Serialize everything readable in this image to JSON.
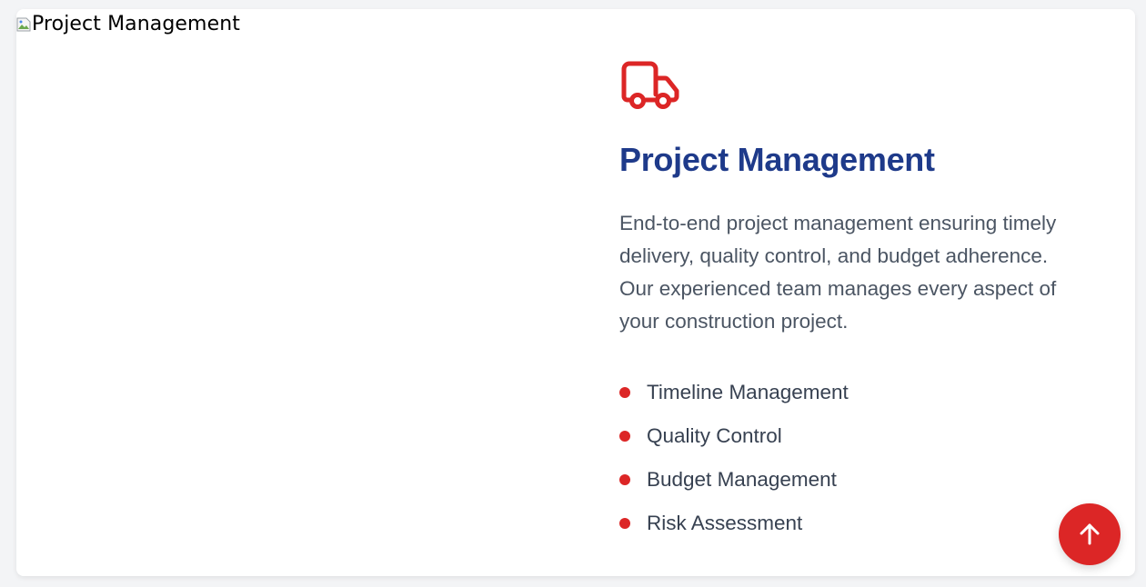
{
  "service": {
    "image_alt": "Project Management",
    "icon": "truck-icon",
    "title": "Project Management",
    "description": "End-to-end project management ensuring timely delivery, quality control, and budget adherence. Our experienced team manages every aspect of your construction project.",
    "features": [
      "Timeline Management",
      "Quality Control",
      "Budget Management",
      "Risk Assessment"
    ]
  },
  "scroll_top": {
    "icon": "arrow-up-icon"
  },
  "colors": {
    "accent": "#dc2626",
    "title": "#1e3a8a",
    "body_text": "#4b5563"
  }
}
